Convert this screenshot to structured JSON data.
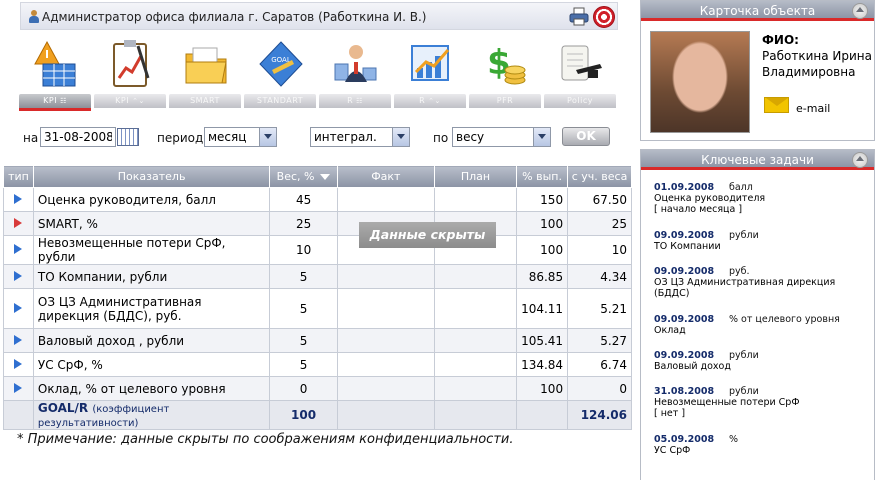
{
  "header": {
    "title": "Администратор офиса филиала г. Саратов  (Работкина И. В.)"
  },
  "toolbar": {
    "items": [
      {
        "label": "KPI",
        "ext": "☷",
        "icon": "warning-grid-icon"
      },
      {
        "label": "KPI",
        "ext": "⌃⌄",
        "icon": "clipboard-chart-icon"
      },
      {
        "label": "SMART",
        "ext": "",
        "icon": "folder-icon"
      },
      {
        "label": "STANDART",
        "ext": "",
        "icon": "goal-book-icon"
      },
      {
        "label": "R",
        "ext": "☷",
        "icon": "person-rank-icon"
      },
      {
        "label": "R",
        "ext": "⌃⌄",
        "icon": "chart-growth-icon"
      },
      {
        "label": "PFR",
        "ext": "",
        "icon": "money-icon"
      },
      {
        "label": "Policy",
        "ext": "",
        "icon": "diploma-icon"
      }
    ]
  },
  "filters": {
    "date_label": "на",
    "date_value": "31-08-2008",
    "period_label": "период",
    "period_value": "месяц",
    "mode_value": "интеграл.",
    "by_label": "по",
    "by_value": "весу",
    "ok_label": "OK"
  },
  "table": {
    "headers": [
      "тип",
      "Показатель",
      "Вес, %",
      "Факт",
      "План",
      "% вып.",
      "с уч. веса"
    ],
    "rows": [
      {
        "indicator": "Оценка руководителя, балл",
        "weight": "45",
        "pct": "150",
        "weighted": "67.50",
        "flag": "blue"
      },
      {
        "indicator": "SMART, %",
        "weight": "25",
        "pct": "100",
        "weighted": "25",
        "flag": "red"
      },
      {
        "indicator": "Невозмещенные потери СрФ, рубли",
        "weight": "10",
        "pct": "100",
        "weighted": "10",
        "flag": "blue"
      },
      {
        "indicator": "ТО Компании, рубли",
        "weight": "5",
        "pct": "86.85",
        "weighted": "4.34",
        "flag": "blue"
      },
      {
        "indicator": "ОЗ ЦЗ Административная дирекция (БДДС), руб.",
        "weight": "5",
        "pct": "104.11",
        "weighted": "5.21",
        "flag": "blue"
      },
      {
        "indicator": "Валовый доход , рубли",
        "weight": "5",
        "pct": "105.41",
        "weighted": "5.27",
        "flag": "blue"
      },
      {
        "indicator": "УС СрФ, %",
        "weight": "5",
        "pct": "134.84",
        "weighted": "6.74",
        "flag": "blue"
      },
      {
        "indicator": "Оклад, % от целевого уровня",
        "weight": "0",
        "pct": "100",
        "weighted": "0",
        "flag": "blue"
      }
    ],
    "total": {
      "label": "GOAL/R",
      "sublabel": "(коэффициент результативности)",
      "weight": "100",
      "weighted": "124.06"
    },
    "hidden_overlay": "Данные скрыты"
  },
  "note": "* Примечание: данные скрыты по соображениям конфиденциальности.",
  "card": {
    "title": "Карточка объекта",
    "fio_label": "ФИО:",
    "fio_value": "Работкина Ирина Владимировна",
    "email_label": "e-mail"
  },
  "tasks": {
    "title": "Ключевые задачи",
    "items": [
      {
        "date": "01.09.2008",
        "unit": "балл",
        "text": "Оценка руководителя",
        "extra": "[ начало месяца ]"
      },
      {
        "date": "09.09.2008",
        "unit": "рубли",
        "text": "ТО Компании",
        "extra": ""
      },
      {
        "date": "09.09.2008",
        "unit": "руб.",
        "text": "ОЗ ЦЗ Административная дирекция (БДДС)",
        "extra": ""
      },
      {
        "date": "09.09.2008",
        "unit": "% от целевого уровня",
        "text": "Оклад",
        "extra": ""
      },
      {
        "date": "09.09.2008",
        "unit": "рубли",
        "text": "Валовый доход",
        "extra": ""
      },
      {
        "date": "31.08.2008",
        "unit": "рубли",
        "text": "Невозмещенные потери СрФ",
        "extra": "[ нет ]"
      },
      {
        "date": "05.09.2008",
        "unit": "%",
        "text": "УС СрФ",
        "extra": ""
      }
    ]
  }
}
